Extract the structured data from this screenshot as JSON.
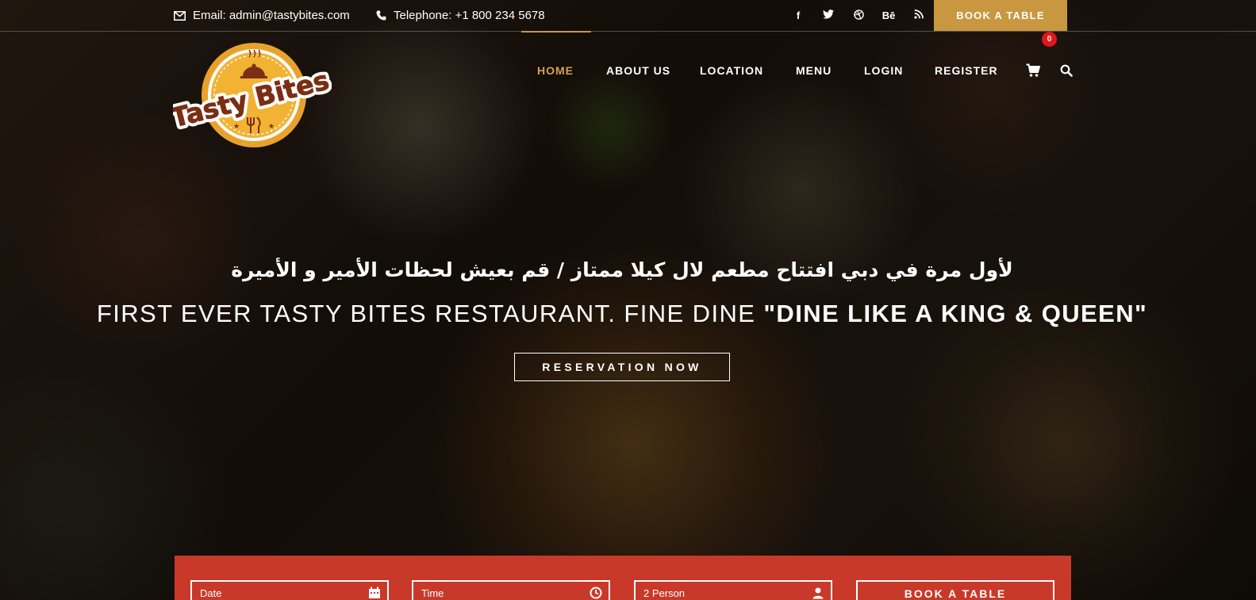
{
  "topbar": {
    "email": "Email: admin@tastybites.com",
    "telephone": "Telephone: +1 800 234 5678",
    "social": {
      "facebook": "f",
      "twitter": "twitter-icon",
      "dribbble": "dribbble-icon",
      "behance": "Bē",
      "rss": "rss-icon"
    },
    "book_label": "BOOK A TABLE"
  },
  "logo": {
    "text": "Tasty Bites",
    "colors": {
      "ring": "#e8a22c",
      "text": "#7a2f14",
      "fill": "#fff"
    }
  },
  "nav": {
    "items": [
      "HOME",
      "ABOUT US",
      "LOCATION",
      "MENU",
      "LOGIN",
      "REGISTER"
    ],
    "active": "HOME",
    "cart_count": "0"
  },
  "hero": {
    "arabic_line": "لأول مرة في دبي افتتاح مطعم لال كيلا ممتاز / قم بعيش لحظات الأمير و الأميرة",
    "headline_regular": "FIRST EVER TASTY BITES RESTAURANT. FINE DINE ",
    "headline_bold": "\"DINE LIKE A KING & QUEEN\"",
    "button_label": "RESERVATION NOW"
  },
  "reservation": {
    "date_placeholder": "Date",
    "time_placeholder": "Time",
    "persons_value": "2 Person",
    "submit_label": "BOOK A TABLE"
  },
  "colors": {
    "accent": "#c9973f",
    "nav_active": "#d4a152",
    "reservation_bar": "#c8392a",
    "badge": "#e3151b"
  }
}
